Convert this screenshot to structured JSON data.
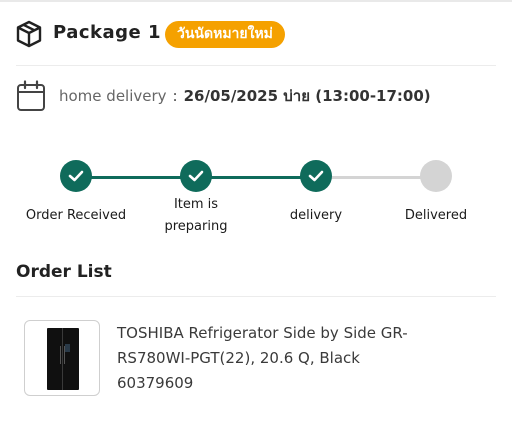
{
  "package": {
    "title": "Package 1",
    "badge": "วันนัดหมายใหม่",
    "badge_color": "#F5A100",
    "icon": "package-icon"
  },
  "delivery": {
    "icon": "calendar-icon",
    "type": "home delivery",
    "separator": ":",
    "datetime": "26/05/2025 บ่าย (13:00-17:00)"
  },
  "tracker": {
    "accent_color": "#0F6B5B",
    "pending_color": "#D4D4D4",
    "steps": [
      {
        "label": "Order Received",
        "status": "done"
      },
      {
        "label": "Item is\npreparing",
        "status": "done"
      },
      {
        "label": "delivery",
        "status": "done"
      },
      {
        "label": "Delivered",
        "status": "pending"
      }
    ]
  },
  "order_list": {
    "title": "Order List",
    "items": [
      {
        "name": "TOSHIBA Refrigerator Side by Side GR-RS780WI-PGT(22), 20.6 Q, Black",
        "sku": "60379609",
        "image": "refrigerator-image"
      }
    ]
  }
}
